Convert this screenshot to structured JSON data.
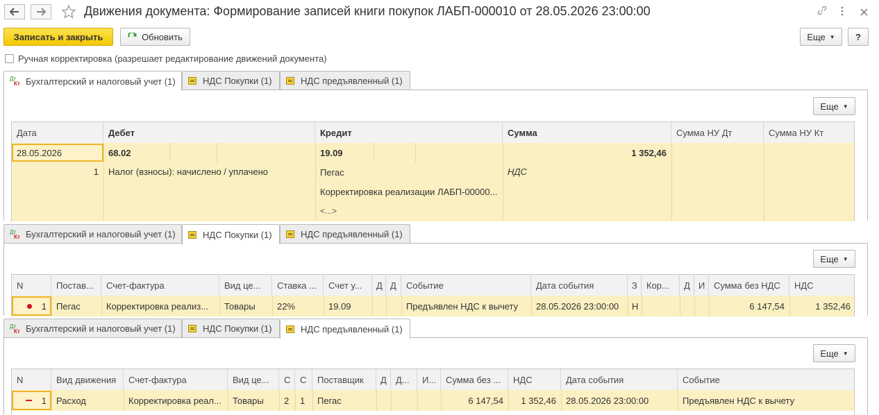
{
  "window": {
    "title": "Движения документа: Формирование записей книги покупок ЛАБП-000010 от 28.05.2026 23:00:00"
  },
  "toolbar": {
    "save_close": "Записать и закрыть",
    "refresh": "Обновить",
    "more": "Еще",
    "help": "?"
  },
  "manual": {
    "label": "Ручная корректировка (разрешает редактирование движений документа)"
  },
  "tabs": [
    "Бухгалтерский и налоговый учет (1)",
    "НДС Покупки (1)",
    "НДС предъявленный (1)"
  ],
  "more": "Еще",
  "accounting": {
    "headers": [
      "Дата",
      "Дебет",
      "Кредит",
      "Сумма",
      "Сумма НУ Дт",
      "Сумма НУ Кт"
    ],
    "row": {
      "date": "28.05.2026",
      "num": "1",
      "debit": "68.02",
      "debit_sub": "Налог (взносы): начислено / уплачено",
      "credit": "19.09",
      "credit_sub1": "Пегас",
      "credit_sub2": "Корректировка реализации ЛАБП-00000...",
      "credit_sub3": "<...>",
      "sum": "1 352,46",
      "sum_sub": "НДС"
    }
  },
  "purchases": {
    "headers": [
      "N",
      "Постав...",
      "Счет-фактура",
      "Вид це...",
      "Ставка ...",
      "Счет у...",
      "Д",
      "Д",
      "Событие",
      "Дата события",
      "З",
      "Кор...",
      "Д",
      "И",
      "Сумма без НДС",
      "НДС"
    ],
    "row": {
      "n": "1",
      "supplier": "Пегас",
      "invoice": "Корректировка реализ...",
      "type": "Товары",
      "rate": "22%",
      "account": "19.09",
      "event": "Предъявлен НДС к вычету",
      "event_date": "28.05.2026 23:00:00",
      "z": "Н",
      "sum_no_vat": "6 147,54",
      "vat": "1 352,46"
    }
  },
  "presented": {
    "headers": [
      "N",
      "Вид движения",
      "Счет-фактура",
      "Вид це...",
      "С",
      "С",
      "Поставщик",
      "Д",
      "Д...",
      "И...",
      "Сумма без ...",
      "НДС",
      "Дата события",
      "Событие"
    ],
    "row": {
      "n": "1",
      "movement": "Расход",
      "invoice": "Корректировка реал...",
      "type": "Товары",
      "c1": "2",
      "c2": "1",
      "supplier": "Пегас",
      "sum_no_vat": "6 147,54",
      "vat": "1 352,46",
      "event_date": "28.05.2026 23:00:00",
      "event": "Предъявлен НДС к вычету"
    }
  },
  "colors": {
    "primary": "#f4c800",
    "row_highlight": "#fbf0c2",
    "selection": "#f0b428",
    "income_marker": "#c8171f",
    "expense_marker": "#d02020"
  }
}
